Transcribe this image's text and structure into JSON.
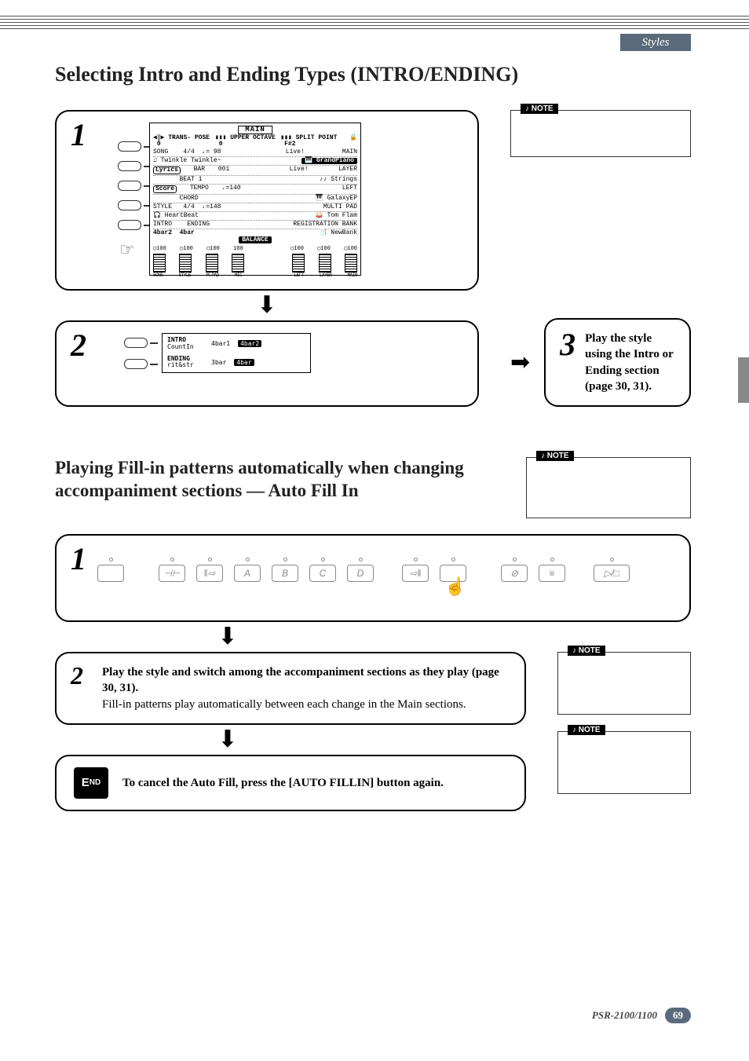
{
  "chapter": "Styles",
  "footer": {
    "model": "PSR-2100/1100",
    "page": "69"
  },
  "note_label": "NOTE",
  "section1": {
    "heading": "Selecting Intro and Ending Types (INTRO/ENDING)",
    "step1": {
      "num": "1",
      "screen": {
        "title": "MAIN",
        "top_icons": {
          "transpose": "TRANS-\nPOSE",
          "transpose_val": "0",
          "upper_octave": "UPPER\nOCTAVE",
          "upper_octave_val": "0",
          "split": "SPLIT\nPOINT",
          "split_val": "F#2",
          "tempo_lock": "F#2"
        },
        "rows": [
          {
            "l1": "SONG",
            "l2": "4/4",
            "l3": "♩= 98",
            "r1": "Live!",
            "r2": "MAIN"
          },
          {
            "song": "♫ Twinkle Twinkle~",
            "voice": "GrandPiano"
          },
          {
            "pill": "Lyrics",
            "a": "BAR",
            "av": "001",
            "r1": "Live!",
            "r2": "LAYER"
          },
          {
            "blank": "",
            "a": "BEAT",
            "av": "1",
            "voice": "♪♪ Strings"
          },
          {
            "pill": "Score",
            "a": "TEMPO",
            "av": "♩=140",
            "r2": "LEFT"
          },
          {
            "blank": "",
            "a": "CHORD",
            "voice": "🎹 GalaxyEP"
          },
          {
            "l1": "STYLE",
            "l2": "4/4",
            "l3": "♩=148",
            "r2": "MULTI PAD"
          },
          {
            "style": "🎧 HeartBeat",
            "mpad": "🥁 Tom Flam"
          },
          {
            "l1": "INTRO",
            "l2": "ENDING",
            "r2": "REGISTRATION BANK"
          },
          {
            "intro": "4bar2",
            "ending": "4bar",
            "bank": "📑 NewBank"
          }
        ],
        "balance_title": "BALANCE",
        "balance_vals": [
          "◯100",
          "◯100",
          "◯100",
          "100",
          "",
          "◯100",
          "◯100",
          "◯100"
        ],
        "balance_labels": [
          "SONG",
          "STYLE",
          "M.PAD",
          "MIC",
          "",
          "LEFT",
          "LAYER",
          "MAIN"
        ]
      }
    },
    "step2": {
      "num": "2",
      "screen": {
        "intro_label": "INTRO",
        "intro_sub": "CountIn",
        "intro_opts": [
          "4bar1",
          "4bar2"
        ],
        "intro_sel": 1,
        "ending_label": "ENDING",
        "ending_sub": "rit&str",
        "ending_opts": [
          "3bar",
          "4bar"
        ],
        "ending_sel": 1
      }
    },
    "step3": {
      "num": "3",
      "text": "Play the style using the Intro or Ending section (page 30, 31)."
    }
  },
  "section2": {
    "heading": "Playing Fill-in patterns automatically when changing accompaniment sections — Auto Fill In",
    "step1": {
      "num": "1",
      "buttons": [
        "",
        "⊣⊢",
        "‖⇨",
        "A",
        "B",
        "C",
        "D",
        "⇨‖",
        "",
        "⊘",
        "≡",
        "▷/□"
      ]
    },
    "step2": {
      "num": "2",
      "bold": "Play the style and switch among the accompaniment sections as they play (page 30, 31).",
      "plain": "Fill-in patterns play automatically between each change in the Main sections."
    },
    "end": {
      "label": "END",
      "text": "To cancel the Auto Fill, press the [AUTO FILLIN] button again."
    }
  }
}
